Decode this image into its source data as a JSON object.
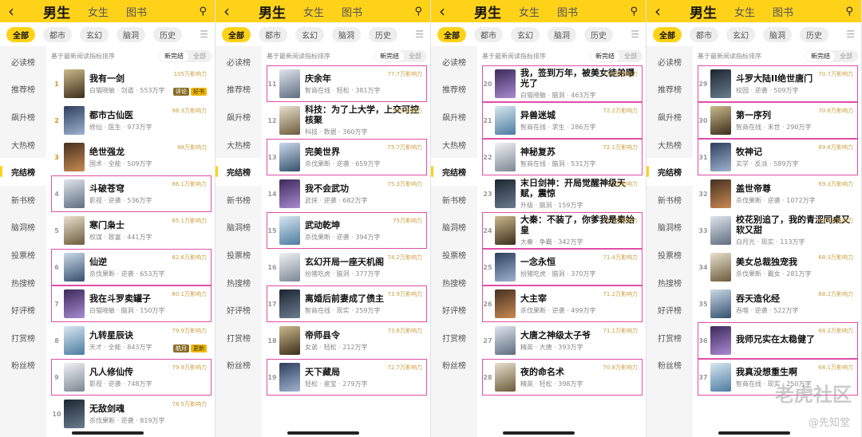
{
  "colors": {
    "accent": "#ffd21a",
    "highlight_box": "#e04ea8"
  },
  "ui": {
    "back_icon": "chevron-left-icon",
    "tabs": [
      "男生",
      "女生",
      "图书"
    ],
    "categories": [
      "全部",
      "都市",
      "玄幻",
      "脑洞",
      "历史"
    ],
    "sidebar": [
      "必读榜",
      "推荐榜",
      "飙升榜",
      "大热榜",
      "完结榜",
      "新书榜",
      "脑洞榜",
      "投票榜",
      "热搜榜",
      "好评榜",
      "打赏榜",
      "粉丝榜"
    ],
    "active_sidebar": "完结榜",
    "subhead": "基于最新阅读指标排序",
    "toggle": [
      "新完结",
      "全部"
    ]
  },
  "watermark": {
    "main": "老虎社区",
    "sub": "@先知堂"
  },
  "panels": [
    {
      "books": [
        {
          "rank": "1",
          "title": "我有一剑",
          "meta": "白猫晓敏 · 剑道 · 553万字",
          "heat": "105万影响力",
          "highlight": false,
          "badges": [
            "评论",
            "好书"
          ]
        },
        {
          "rank": "2",
          "title": "都市古仙医",
          "meta": "修仙 · 医生 · 973万字",
          "heat": "98.3万影响力",
          "highlight": false
        },
        {
          "rank": "3",
          "title": "绝世强龙",
          "meta": "国术 · 全能 · 509万字",
          "heat": "88万影响力",
          "highlight": false
        },
        {
          "rank": "4",
          "title": "斗破苍穹",
          "meta": "影视 · 逆袭 · 536万字",
          "heat": "86.1万影响力",
          "highlight": true
        },
        {
          "rank": "5",
          "title": "寒门枭士",
          "meta": "权谋 · 致富 · 441万字",
          "heat": "85.1万影响力",
          "highlight": false
        },
        {
          "rank": "6",
          "title": "仙逆",
          "meta": "杀伐果断 · 逆袭 · 653万字",
          "heat": "82.6万影响力",
          "highlight": true
        },
        {
          "rank": "7",
          "title": "我在斗罗卖罐子",
          "meta": "白猫晓敏 · 脑洞 · 150万字",
          "heat": "80.1万影响力",
          "highlight": true
        },
        {
          "rank": "8",
          "title": "九转星辰诀",
          "meta": "天才 · 全能 · 843万字",
          "heat": "79.9万影响力",
          "highlight": false,
          "badges": [
            "航月",
            "更新"
          ]
        },
        {
          "rank": "9",
          "title": "凡人修仙传",
          "meta": "影视 · 逆袭 · 748万字",
          "heat": "79.9万影响力",
          "highlight": true
        },
        {
          "rank": "10",
          "title": "无敌剑魂",
          "meta": "杀伐果断 · 逆袭 · 819万字",
          "heat": "78.5万影响力",
          "highlight": false
        }
      ]
    },
    {
      "books": [
        {
          "rank": "11",
          "title": "庆余年",
          "meta": "智商在线 · 轻松 · 381万字",
          "heat": "77.7万影响力",
          "highlight": true
        },
        {
          "rank": "12",
          "title": "科技：为了上大学，上交可控核聚",
          "meta": "科技 · 数据 · 360万字",
          "heat": "76万影响力",
          "highlight": false
        },
        {
          "rank": "13",
          "title": "完美世界",
          "meta": "杀伐果断 · 逆袭 · 659万字",
          "heat": "75.7万影响力",
          "highlight": true
        },
        {
          "rank": "14",
          "title": "我不会武功",
          "meta": "武侠 · 逆袭 · 682万字",
          "heat": "75.3万影响力",
          "highlight": false
        },
        {
          "rank": "15",
          "title": "武动乾坤",
          "meta": "杀伐果断 · 逆袭 · 394万字",
          "heat": "75万影响力",
          "highlight": true
        },
        {
          "rank": "16",
          "title": "玄幻开局一座天机阁",
          "meta": "扮猪吃虎 · 脑洞 · 377万字",
          "heat": "74.2万影响力",
          "highlight": false
        },
        {
          "rank": "17",
          "title": "离婚后前妻成了债主",
          "meta": "智商在线 · 现实 · 259万字",
          "heat": "73.9万影响力",
          "highlight": true
        },
        {
          "rank": "18",
          "title": "帝师县令",
          "meta": "女弟 · 轻松 · 212万字",
          "heat": "73.6万影响力",
          "highlight": false
        },
        {
          "rank": "19",
          "title": "天下藏局",
          "meta": "轻松 · 鉴宝 · 279万字",
          "heat": "72.7万影响力",
          "highlight": true
        }
      ]
    },
    {
      "books": [
        {
          "rank": "20",
          "title": "我，签到万年，被美女徒弟曝光了",
          "meta": "白猫晓敏 · 脑洞 · 463万字",
          "heat": "72.6万影响力",
          "highlight": true
        },
        {
          "rank": "21",
          "title": "异兽迷城",
          "meta": "智商在线 · 求生 · 286万字",
          "heat": "72.2万影响力",
          "highlight": true
        },
        {
          "rank": "22",
          "title": "神秘复苏",
          "meta": "智商在线 · 脑洞 · 531万字",
          "heat": "72.1万影响力",
          "highlight": true
        },
        {
          "rank": "23",
          "title": "末日剑神：开局觉醒神级天赋，震惊",
          "meta": "升级 · 脑洞 · 159万字",
          "heat": "72万影响力",
          "highlight": false
        },
        {
          "rank": "24",
          "title": "大秦：不装了，你爹我是秦始皇",
          "meta": "大秦 · 争霸 · 342万字",
          "heat": "71.7万影响力",
          "highlight": true
        },
        {
          "rank": "25",
          "title": "一念永恒",
          "meta": "扮猪吃虎 · 脑洞 · 370万字",
          "heat": "71.4万影响力",
          "highlight": true
        },
        {
          "rank": "26",
          "title": "大主宰",
          "meta": "杀伐果断 · 逆袭 · 499万字",
          "heat": "71.2万影响力",
          "highlight": true
        },
        {
          "rank": "27",
          "title": "大唐之神级太子爷",
          "meta": "精英 · 大唐 · 393万字",
          "heat": "71.1万影响力",
          "highlight": false
        },
        {
          "rank": "28",
          "title": "夜的命名术",
          "meta": "精英 · 轻松 · 398万字",
          "heat": "70.8万影响力",
          "highlight": true
        }
      ]
    },
    {
      "books": [
        {
          "rank": "29",
          "title": "斗罗大陆II绝世唐门",
          "meta": "校园 · 逆袭 · 509万字",
          "heat": "70.7万影响力",
          "highlight": true
        },
        {
          "rank": "30",
          "title": "第一序列",
          "meta": "智商在线 · 末世 · 290万字",
          "heat": "70.6万影响力",
          "highlight": true
        },
        {
          "rank": "31",
          "title": "牧神记",
          "meta": "玄学 · 反派 · 589万字",
          "heat": "69.6万影响力",
          "highlight": true
        },
        {
          "rank": "32",
          "title": "盖世帝尊",
          "meta": "杀伐果断 · 逆袭 · 1072万字",
          "heat": "69.3万影响力",
          "highlight": false
        },
        {
          "rank": "33",
          "title": "校花别追了，我的青涩同桌又软又甜",
          "meta": "白月光 · 现实 · 113万字",
          "heat": "68.4万影响力",
          "highlight": false
        },
        {
          "rank": "34",
          "title": "美女总裁独宠我",
          "meta": "杀伐果断 · 霸女 · 281万字",
          "heat": "68.3万影响力",
          "highlight": false
        },
        {
          "rank": "35",
          "title": "吞天造化经",
          "meta": "吞噬 · 逆袭 · 522万字",
          "heat": "68.2万影响力",
          "highlight": false
        },
        {
          "rank": "36",
          "title": "我师兄实在太稳健了",
          "meta": "",
          "heat": "68.2万影响力",
          "highlight": true
        },
        {
          "rank": "37",
          "title": "我真没想重生啊",
          "meta": "智商在线 · 现实 · 250万字",
          "heat": "68.1万影响力",
          "highlight": true
        }
      ]
    }
  ]
}
